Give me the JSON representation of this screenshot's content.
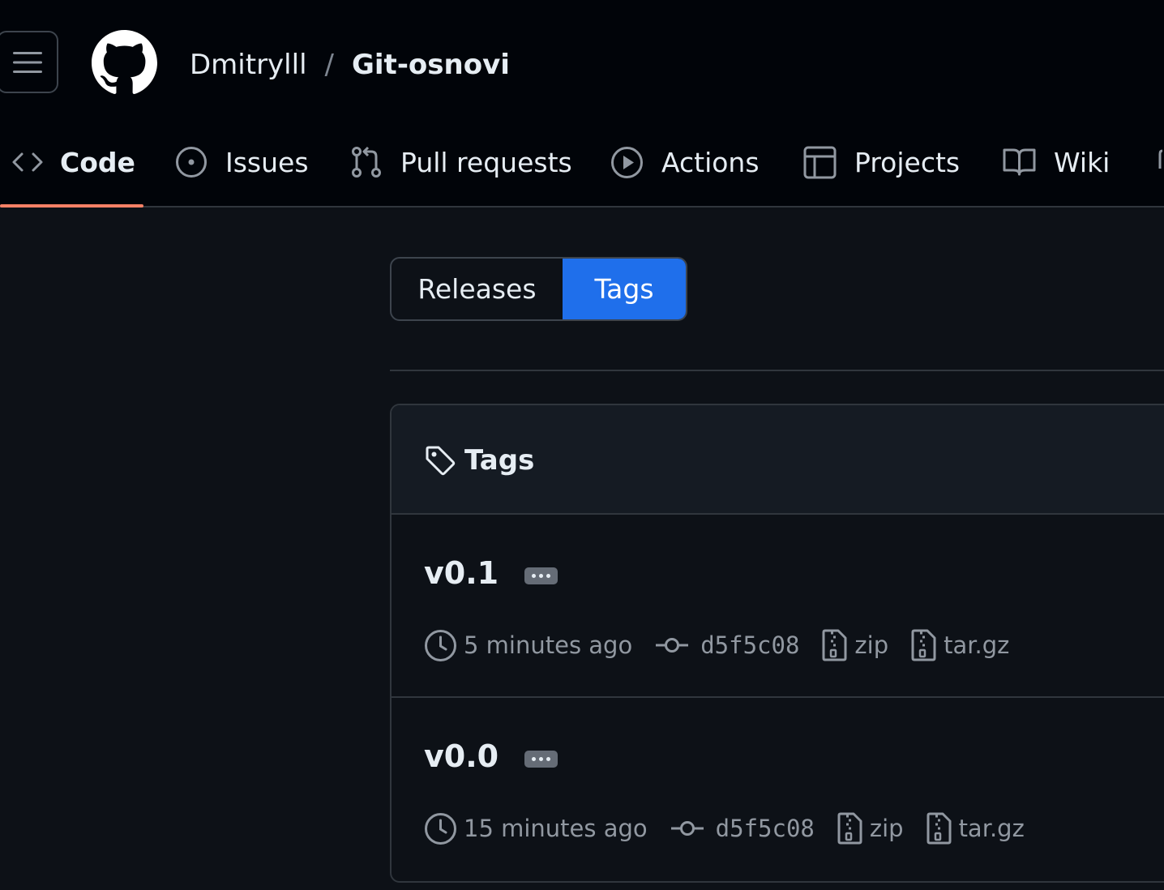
{
  "header": {
    "owner": "Dmitrylll",
    "separator": "/",
    "repo": "Git-osnovi"
  },
  "nav": {
    "items": [
      {
        "label": "Code",
        "icon": "code-icon",
        "active": true
      },
      {
        "label": "Issues",
        "icon": "issue-opened-icon"
      },
      {
        "label": "Pull requests",
        "icon": "git-pull-request-icon"
      },
      {
        "label": "Actions",
        "icon": "play-icon"
      },
      {
        "label": "Projects",
        "icon": "table-icon"
      },
      {
        "label": "Wiki",
        "icon": "book-icon"
      }
    ]
  },
  "segmented": {
    "releases": "Releases",
    "tags": "Tags",
    "selected": "Tags"
  },
  "tags_box": {
    "title": "Tags",
    "rows": [
      {
        "name": "v0.1",
        "time": "5 minutes ago",
        "commit": "d5f5c08",
        "zip": "zip",
        "targz": "tar.gz"
      },
      {
        "name": "v0.0",
        "time": "15 minutes ago",
        "commit": "d5f5c08",
        "zip": "zip",
        "targz": "tar.gz"
      }
    ]
  },
  "colors": {
    "background": "#0d1117",
    "header_bg": "#010409",
    "accent_underline": "#f78166",
    "selected_button": "#1f6feb",
    "muted_text": "#9198a1"
  }
}
